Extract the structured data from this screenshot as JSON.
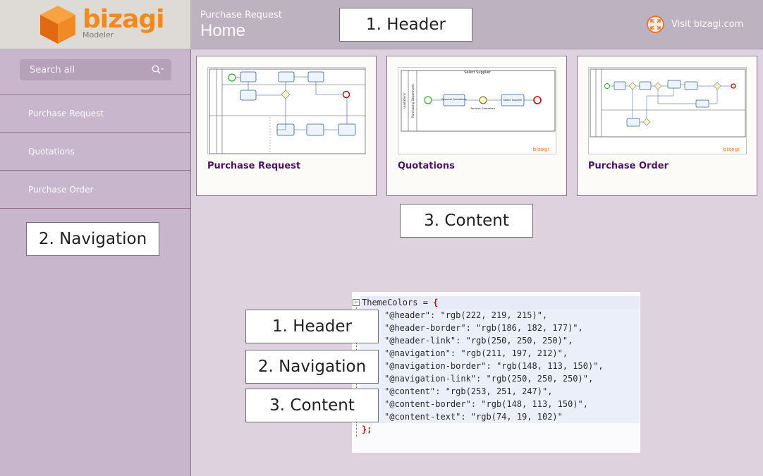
{
  "brand": {
    "name": "bizagi",
    "subtitle": "Modeler"
  },
  "header": {
    "subtitle": "Purchase Request",
    "title": "Home",
    "link_label": "Visit bizagi.com"
  },
  "search": {
    "placeholder": "Search all"
  },
  "nav": {
    "items": [
      {
        "label": "Purchase Request"
      },
      {
        "label": "Quotations"
      },
      {
        "label": "Purchase Order"
      }
    ]
  },
  "labels": {
    "header": "1. Header",
    "navigation": "2. Navigation",
    "content": "3. Content"
  },
  "cards": [
    {
      "title": "Purchase Request"
    },
    {
      "title": "Quotations",
      "diagram_title": "Select Supplier",
      "lane": "Quotations",
      "sublane": "Purchasing Department",
      "task1": "Request Quotations",
      "task2": "Select Supplier",
      "event": "Receive Quotations"
    },
    {
      "title": "Purchase Order"
    }
  ],
  "code": {
    "first_line": "ThemeColors = ",
    "open_brace": "{",
    "close": "};",
    "entries": [
      "\"@header\": \"rgb(222, 219, 215)\",",
      "\"@header-border\": \"rgb(186, 182, 177)\",",
      "\"@header-link\": \"rgb(250, 250, 250)\",",
      "\"@navigation\": \"rgb(211, 197, 212)\",",
      "\"@navigation-border\": \"rgb(148, 113, 150)\",",
      "\"@navigation-link\": \"rgb(250, 250, 250)\",",
      "\"@content\": \"rgb(253, 251, 247)\",",
      "\"@content-border\": \"rgb(148, 113, 150)\",",
      "\"@content-text\": \"rgb(74, 19, 102)\""
    ]
  },
  "colors": {
    "accent_orange": "#f08a1e",
    "card_title": "#4a1366",
    "nav_border": "#94718f"
  }
}
